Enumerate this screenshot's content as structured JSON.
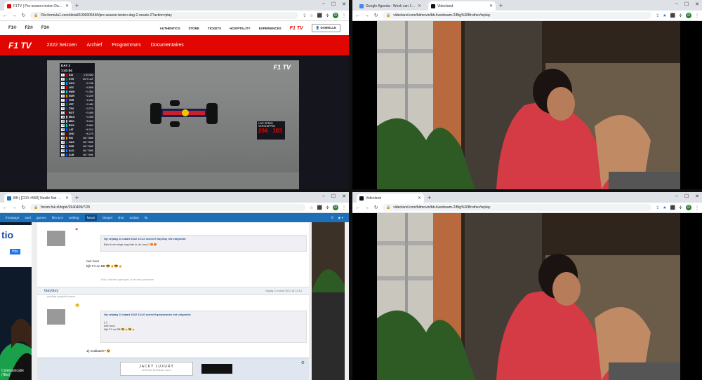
{
  "colors": {
    "f1_red": "#e10600",
    "fok_blue": "#1d6fb8",
    "chrome_tabstrip": "#dee1e6",
    "profile_green": "#2e7d32"
  },
  "f1_window": {
    "tab_title": "F1TV | Pre-season testen Dag...",
    "url": "f1tv.formula1.com/detail/1000005440/pre-season-testen-dag-2-sessie-2?action=play",
    "brands": [
      "F1®",
      "F2®",
      "F3®"
    ],
    "links": [
      "AUTHENTICS",
      "STORE",
      "TICKETS",
      "HOSPITALITY",
      "EXPERIENCES"
    ],
    "logo": "F1 TV",
    "user_button": "DANIELLE",
    "nav": [
      "2022 Seizoen",
      "Archief",
      "Programma's",
      "Documentaires"
    ],
    "player": {
      "day_label": "DAY 2",
      "timer": "1:41:04",
      "leaderboard": [
        {
          "pos": "1",
          "drv": "SAI",
          "gap": "1:33.532",
          "color": "#dc0000"
        },
        {
          "pos": "2",
          "drv": "STR",
          "gap": "OUT LAP",
          "color": "#006f62"
        },
        {
          "pos": "3",
          "drv": "OCO",
          "gap": "+0.768",
          "color": "#0090ff"
        },
        {
          "pos": "4",
          "drv": "LEC",
          "gap": "+0.836",
          "color": "#dc0000"
        },
        {
          "pos": "5",
          "drv": "HAM",
          "gap": "+1.364",
          "color": "#00d2be"
        },
        {
          "pos": "6",
          "drv": "NOR",
          "gap": "+2.229",
          "color": "#ff8700"
        },
        {
          "pos": "7",
          "drv": "VER",
          "gap": "+2.242",
          "color": "#1e41ff"
        },
        {
          "pos": "8",
          "drv": "VET",
          "gap": "+2.480",
          "color": "#006f62"
        },
        {
          "pos": "9",
          "drv": "TSU",
          "gap": "+3.270",
          "color": "#2b4562"
        },
        {
          "pos": "10",
          "drv": "BOT",
          "gap": "+3.455",
          "color": "#900000"
        },
        {
          "pos": "11",
          "drv": "MAG",
          "gap": "+4.306",
          "color": "#b6babd"
        },
        {
          "pos": "12",
          "drv": "MSC",
          "gap": "+5.314",
          "color": "#b6babd"
        },
        {
          "pos": "13",
          "drv": "RUS",
          "gap": "+5.663",
          "color": "#00d2be"
        },
        {
          "pos": "14",
          "drv": "LAT",
          "gap": "+6.313",
          "color": "#005aff"
        },
        {
          "pos": "15",
          "drv": "ZHO",
          "gap": "+6.275",
          "color": "#900000"
        },
        {
          "pos": "16",
          "drv": "RIC",
          "gap": "NO TIME",
          "color": "#ff8700"
        },
        {
          "pos": "17",
          "drv": "GAS",
          "gap": "NO TIME",
          "color": "#2b4562"
        },
        {
          "pos": "18",
          "drv": "PER",
          "gap": "NO TIME",
          "color": "#1e41ff"
        },
        {
          "pos": "19",
          "drv": "ALO",
          "gap": "NO TIME",
          "color": "#0090ff"
        },
        {
          "pos": "20",
          "drv": "ALB",
          "gap": "NO TIME",
          "color": "#005aff"
        }
      ],
      "live_speed_label": "LIVE SPEED",
      "live_speed_driver": "VERSTAPPEN",
      "speed_left": "294",
      "speed_right": "183",
      "watermark": "F1 TV"
    }
  },
  "video_top": {
    "tabs": [
      {
        "title": "Google Agenda - Week van 13...",
        "active": false
      },
      {
        "title": "Videoland",
        "active": true
      }
    ],
    "url": "videoland.com/bitmovin/bb-livestream-2/Big%20Brother/replay"
  },
  "video_bottom": {
    "tabs": [
      {
        "title": "Videoland",
        "active": true
      }
    ],
    "url": "videoland.com/bitmovin/bb-livestream-2/Big%20Brother/replay"
  },
  "forum_window": {
    "tab_title": "BB | [CDX #568] Nestle Nat mo...",
    "url": "forum.fok.nl/topic/2640409/7/25",
    "nav": [
      "frontpage",
      "spel",
      "games",
      "film & tv",
      "weblog",
      "forum",
      "bbspel",
      "shot",
      "sodaw",
      "ilu"
    ],
    "active_nav": "forum",
    "post1": {
      "quote_by": "Op vrijdag 11 maart 2022 13:12 schreef GayGuy het volgende:",
      "quote_text": "Ben ik de enige nog hier in de cosa? 😍😍",
      "reply_lines": [
        "nee hoor",
        "kijk F1 en BB 😎🍺😎🍺"
      ],
      "footnote": "Je bij n het hele opdrooges, ik een ben goenlooren"
    },
    "post2": {
      "user": "GayGuy",
      "user_sub": "gezellige spaghetti plaaper",
      "meta": "vrijdag 11 maart 2022 @ 13:14",
      "quote_by": "Op vrijdag 11 maart 2022 13:16 schreef greydzones het volgende:",
      "quote_lines": [
        "[..]",
        "nee hoor",
        "kijk F1 en BB 😎🍺😎🍺"
      ],
      "reply": "Jij multitask!? 😍"
    },
    "ad_brand": "JACKY LUXURY",
    "ad_sub": "SPRING/SUMMER 2022",
    "left_ad": {
      "logo": "tio",
      "badge": "Hbo",
      "footer": "Communicatie (Hbo)"
    }
  }
}
